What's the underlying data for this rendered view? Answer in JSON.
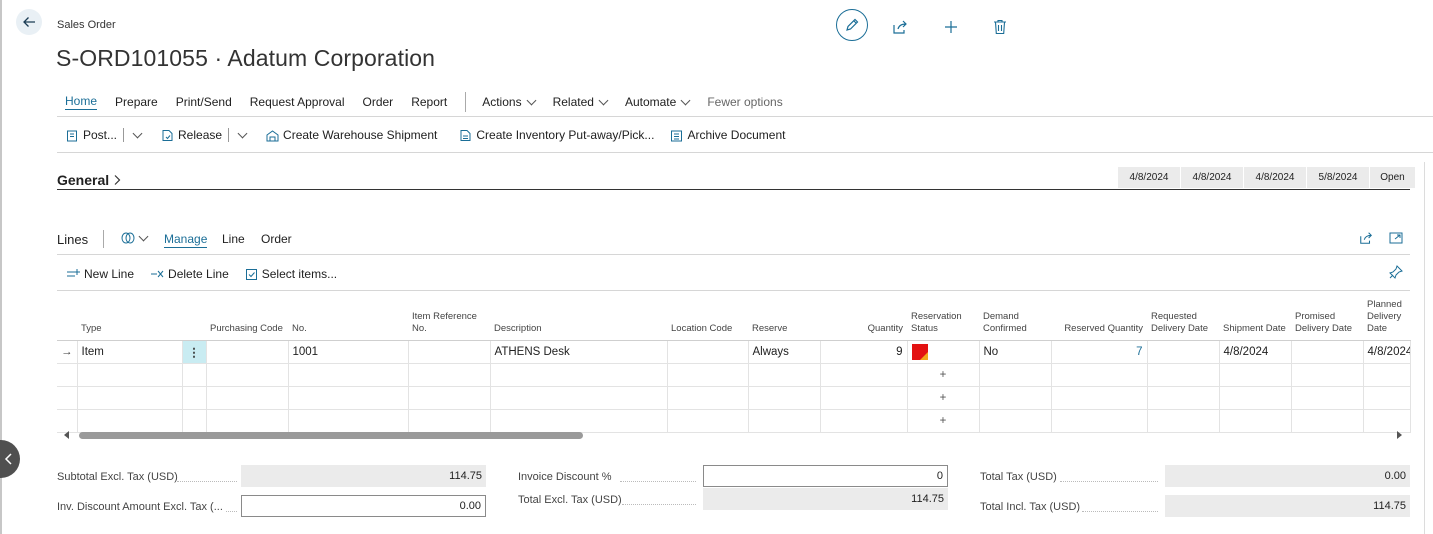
{
  "page": {
    "kind": "Sales Order",
    "title": "S-ORD101055 · Adatum Corporation"
  },
  "header_actions": [
    "edit-icon",
    "share-icon",
    "add-icon",
    "delete-icon"
  ],
  "menu": {
    "items": [
      "Home",
      "Prepare",
      "Print/Send",
      "Request Approval",
      "Order",
      "Report"
    ],
    "dropdowns": [
      "Actions",
      "Related",
      "Automate"
    ],
    "fewer": "Fewer options"
  },
  "actions": {
    "post": "Post...",
    "release": "Release",
    "warehouse": "Create Warehouse Shipment",
    "inventory": "Create Inventory Put-away/Pick...",
    "archive": "Archive Document"
  },
  "general": {
    "title": "General",
    "chips": [
      "4/8/2024",
      "4/8/2024",
      "4/8/2024",
      "5/8/2024",
      "Open"
    ]
  },
  "lines": {
    "title": "Lines",
    "tabs": [
      "Manage",
      "Line",
      "Order"
    ],
    "actions": {
      "new_line": "New Line",
      "delete_line": "Delete Line",
      "select_items": "Select items..."
    },
    "columns": {
      "type": "Type",
      "purchasing_code": "Purchasing Code",
      "no": "No.",
      "item_ref": "Item Reference No.",
      "description": "Description",
      "location": "Location Code",
      "reserve": "Reserve",
      "quantity": "Quantity",
      "res_status": "Reservation Status",
      "demand_confirmed": "Demand Confirmed",
      "reserved_qty": "Reserved Quantity",
      "req_delivery": "Requested Delivery Date",
      "shipment_date": "Shipment Date",
      "promised_delivery": "Promised Delivery Date",
      "planned_delivery": "Planned Delivery Date"
    },
    "row": {
      "arrow": "→",
      "type": "Item",
      "no": "1001",
      "description": "ATHENS Desk",
      "reserve": "Always",
      "quantity": "9",
      "demand_confirmed": "No",
      "reserved_qty": "7",
      "shipment_date": "4/8/2024",
      "planned_delivery": "4/8/2024"
    }
  },
  "totals": {
    "subtotal_label": "Subtotal Excl. Tax (USD)",
    "subtotal_value": "114.75",
    "inv_disc_amt_label": "Inv. Discount Amount Excl. Tax (...",
    "inv_disc_amt_value": "0.00",
    "inv_disc_pct_label": "Invoice Discount %",
    "inv_disc_pct_value": "0",
    "total_excl_label": "Total Excl. Tax (USD)",
    "total_excl_value": "114.75",
    "total_tax_label": "Total Tax (USD)",
    "total_tax_value": "0.00",
    "total_incl_label": "Total Incl. Tax (USD)",
    "total_incl_value": "114.75"
  },
  "colors": {
    "accent": "#1b6e97",
    "status_red": "#e31212",
    "status_orange": "#f2a71c"
  }
}
